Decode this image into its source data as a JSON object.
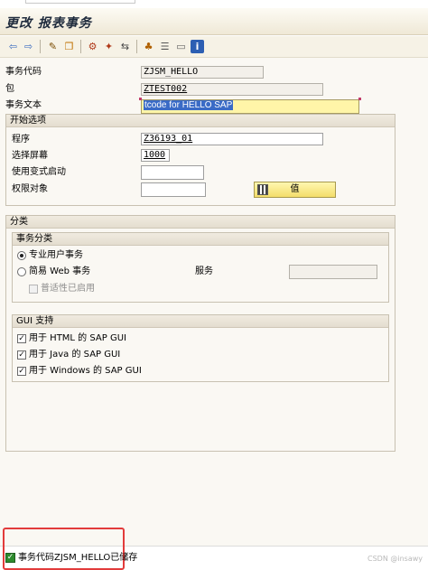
{
  "window": {
    "title": "更改 报表事务"
  },
  "toolbar": {
    "icons": [
      "back-arrow-icon",
      "forward-arrow-icon",
      "display-change-icon",
      "other-object-icon",
      "check-icon",
      "activate-icon",
      "where-used-icon",
      "hierarchy-icon",
      "object-list-icon",
      "window-icon",
      "info-icon"
    ]
  },
  "header": {
    "tcode_label": "事务代码",
    "tcode_value": "ZJSM_HELLO",
    "package_label": "包",
    "package_value": "ZTEST002",
    "text_label": "事务文本",
    "text_value": "tcode for HELLO SAP"
  },
  "start_options": {
    "title": "开始选项",
    "program_label": "程序",
    "program_value": "Z36193_01",
    "screen_label": "选择屏幕",
    "screen_value": "1000",
    "variant_label": "使用变式启动",
    "variant_value": "",
    "auth_label": "权限对象",
    "auth_value": "",
    "value_button": "值"
  },
  "classification": {
    "title": "分类",
    "type_group": "事务分类",
    "radio_professional": "专业用户事务",
    "radio_easy_web": "简易 Web 事务",
    "service_label": "服务",
    "service_value": "",
    "pervasive": "普适性已启用"
  },
  "gui_support": {
    "title": "GUI 支持",
    "html": "用于 HTML 的 SAP GUI",
    "java": "用于 Java 的 SAP GUI",
    "windows": "用于 Windows 的 SAP GUI"
  },
  "status": {
    "message": "事务代码ZJSM_HELLO已储存",
    "watermark": "CSDN @insawy"
  },
  "colors": {
    "highlight_field": "#fff5a8",
    "selection": "#3a6bc6",
    "status_frame": "#e23b3b",
    "success_icon": "#2e8b2e"
  }
}
